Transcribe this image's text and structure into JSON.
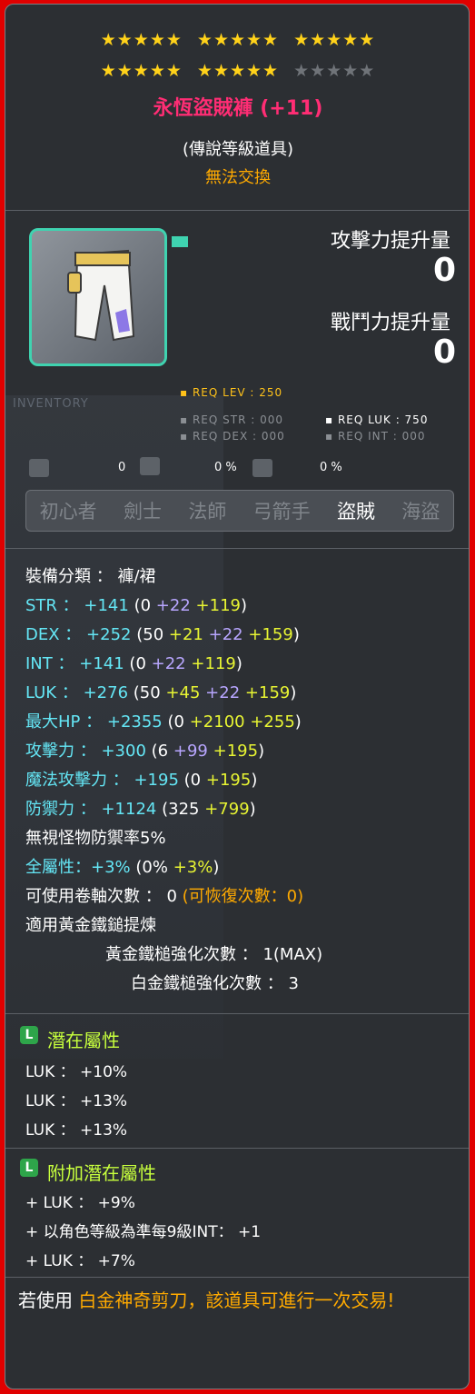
{
  "stars": {
    "filled": 25,
    "total": 30
  },
  "item": {
    "name": "永恆盜賊褲 (+11)",
    "grade": "(傳說等級道具)",
    "trade_status": "無法交換"
  },
  "compare": {
    "attack_label": "攻擊力提升量",
    "attack_value": "0",
    "power_label": "戰鬥力提升量",
    "power_value": "0"
  },
  "requirements": {
    "lev": "REQ LEV : 250",
    "str": "REQ STR : 000",
    "luk": "REQ LUK : 750",
    "dex": "REQ DEX : 000",
    "int": "REQ INT : 000"
  },
  "small_stats": {
    "v1": "0",
    "v2": "0 %",
    "v3": "0 %"
  },
  "background_text": "INVENTORY",
  "jobs": [
    "初心者",
    "劍士",
    "法師",
    "弓箭手",
    "盜賊",
    "海盜"
  ],
  "active_job": "盜賊",
  "stats": {
    "category": "裝備分類 ： 褲/裙",
    "str": {
      "label": "STR  ：",
      "total": "+141",
      "open": "(0",
      "b": "+22",
      "c": "+119",
      "close": ")"
    },
    "dex": {
      "label": "DEX  ：",
      "total": "+252",
      "open": "(50",
      "a": "+21",
      "b": "+22",
      "c": "+159",
      "close": ")"
    },
    "int": {
      "label": "INT  ：",
      "total": "+141",
      "open": "(0",
      "b": "+22",
      "c": "+119",
      "close": ")"
    },
    "luk": {
      "label": "LUK  ：",
      "total": "+276",
      "open": "(50",
      "a": "+45",
      "b": "+22",
      "c": "+159",
      "close": ")"
    },
    "hp": {
      "label": "最大HP  ：",
      "total": "+2355",
      "open": "(0",
      "a": "+2100",
      "c": "+255",
      "close": ")"
    },
    "atk": {
      "label": "攻擊力 ：",
      "total": "+300",
      "open": "(6",
      "b": "+99",
      "c": "+195",
      "close": ")"
    },
    "matk": {
      "label": "魔法攻擊力 ：",
      "total": "+195",
      "open": "(0",
      "c": "+195",
      "close": ")"
    },
    "def": {
      "label": "防禦力 ：",
      "total": "+1124",
      "open": "(325",
      "c": "+799",
      "close": ")"
    },
    "ignore_def": "無視怪物防禦率5%",
    "all_stat": {
      "label": "全屬性：",
      "total": "+3%",
      "open": "(0%",
      "c": "+3%",
      "close": ")"
    },
    "slots": "可使用卷軸次數 ： 0",
    "recover": "(可恢復次數：0)",
    "hammer": "適用黃金鐵鎚提煉",
    "gold_hammer": "黃金鐵槌強化次數 ： 1(MAX)",
    "platinum_hammer": "白金鐵槌強化次數 ： 3"
  },
  "potential": {
    "grade_letter": "L",
    "title": "潛在屬性",
    "lines": [
      "LUK ： +10%",
      "LUK ： +13%",
      "LUK ： +13%"
    ]
  },
  "additional": {
    "grade_letter": "L",
    "title": "附加潛在屬性",
    "lines": [
      "+ LUK ： +9%",
      "+ 以角色等級為準每9級INT： +1",
      "+ LUK ： +7%"
    ]
  },
  "footer": {
    "prefix": "若使用 ",
    "highlight": "白金神奇剪刀，該道具可進行一次交易!"
  }
}
